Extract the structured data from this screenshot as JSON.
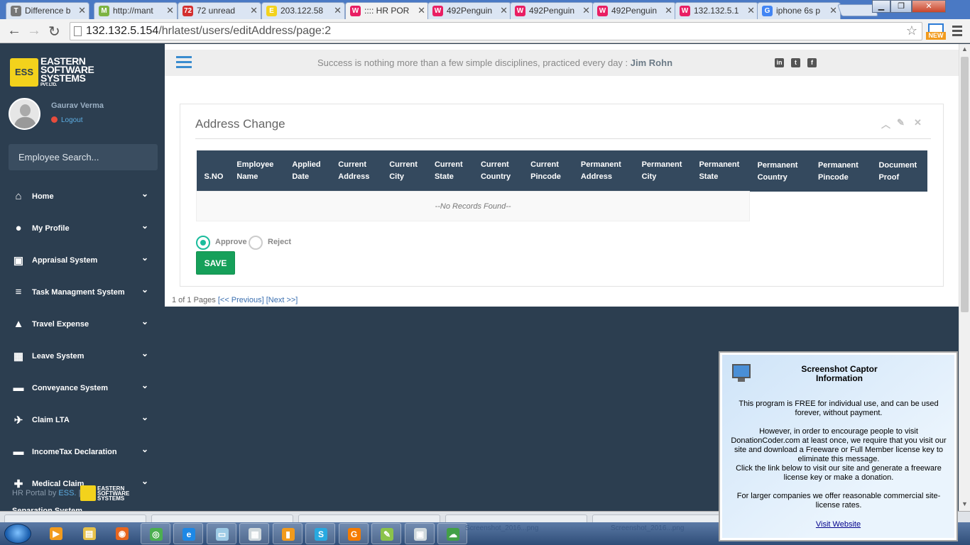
{
  "browser": {
    "tabs": [
      {
        "title": "Difference b",
        "favicon": "T",
        "color": "#777777"
      },
      {
        "title": "http://mant",
        "favicon": "M",
        "color": "#7cb342"
      },
      {
        "title": "72 unread",
        "favicon": "72",
        "color": "#d32f2f"
      },
      {
        "title": "203.122.58",
        "favicon": "E",
        "color": "#f3d21c"
      },
      {
        "title": ":::: HR POR",
        "favicon": "W",
        "color": "#e91e63"
      },
      {
        "title": "492Penguin",
        "favicon": "W",
        "color": "#e91e63"
      },
      {
        "title": "492Penguin",
        "favicon": "W",
        "color": "#e91e63"
      },
      {
        "title": "492Penguin",
        "favicon": "W",
        "color": "#e91e63"
      },
      {
        "title": "132.132.5.1",
        "favicon": "W",
        "color": "#e91e63"
      },
      {
        "title": "iphone 6s p",
        "favicon": "G",
        "color": "#4285f4"
      }
    ],
    "active_tab_index": 4,
    "url_host": "132.132.5.154",
    "url_path": "/hrlatest/users/editAddress/page:2",
    "extension_badge": "NEW"
  },
  "sidebar": {
    "logo_lines": [
      "EASTERN",
      "SOFTWARE",
      "SYSTEMS"
    ],
    "logo_sub": "PVT. LTD.",
    "logo_mark": "ESS",
    "user_name": "Gaurav Verma",
    "logout_label": "Logout",
    "search_placeholder": "Employee Search...",
    "items": [
      {
        "label": "Home",
        "icon": "home-icon",
        "glyph": "⌂"
      },
      {
        "label": "My Profile",
        "icon": "user-icon",
        "glyph": "●"
      },
      {
        "label": "Appraisal System",
        "icon": "money-icon",
        "glyph": "▣"
      },
      {
        "label": "Task Managment System",
        "icon": "list-icon",
        "glyph": "≡"
      },
      {
        "label": "Travel Expense",
        "icon": "road-icon",
        "glyph": "▲"
      },
      {
        "label": "Leave System",
        "icon": "calendar-icon",
        "glyph": "▦"
      },
      {
        "label": "Conveyance System",
        "icon": "truck-icon",
        "glyph": "▬"
      },
      {
        "label": "Claim LTA",
        "icon": "plane-icon",
        "glyph": "✈"
      },
      {
        "label": "IncomeTax Declaration",
        "icon": "truck-icon",
        "glyph": "▬"
      },
      {
        "label": "Medical Claim",
        "icon": "ambulance-icon",
        "glyph": "✚"
      }
    ],
    "footer_text": "HR Portal by",
    "footer_link": "ESS.",
    "footer_sep": "|",
    "cut_item_label": "Separation System"
  },
  "topbar": {
    "quote": "Success is nothing more than a few simple disciplines, practiced every day :",
    "quote_author": "Jim Rohn",
    "social": [
      "in",
      "t",
      "f"
    ]
  },
  "panel": {
    "title": "Address Change",
    "table": {
      "headers": [
        "S.NO",
        "Employee Name",
        "Applied Date",
        "Current Address",
        "Current City",
        "Current State",
        "Current Country",
        "Current Pincode",
        "Permanent Address",
        "Permanent City",
        "Permanent State",
        "Permanent Country",
        "Permanent Pincode",
        "Document Proof"
      ],
      "empty_message": "--No Records Found--"
    },
    "radio_approve": "Approve",
    "radio_reject": "Reject",
    "selected": "Approve",
    "save_label": "SAVE"
  },
  "pager": {
    "text": "1 of 1 Pages",
    "prev": "[<< Previous]",
    "next": "[Next >>]"
  },
  "captor": {
    "title_line1": "Screenshot Captor",
    "title_line2": "Information",
    "p1": "This program is FREE for individual use, and can be used forever, without payment.",
    "p2": "However, in order to encourage people to visit DonationCoder.com at least once, we require that you visit our site and download a Freeware or Full Member license key to eliminate this message.",
    "p3": "Click the link below to visit our site and generate a freeware license key or make a donation.",
    "p4": "For larger companies we offer reasonable commercial site-license rates.",
    "link": "Visit Website"
  },
  "taskbar": {
    "apps": [
      "media-player",
      "file-explorer",
      "firefox",
      "chrome",
      "internet-explorer",
      "notepad",
      "calculator",
      "phone-app",
      "skype",
      "browser-app",
      "editor",
      "screenshot-captor",
      "cloud-sync"
    ],
    "faded_items": [
      "Screenshot_2016...png",
      "Screenshot_2016...png"
    ]
  }
}
